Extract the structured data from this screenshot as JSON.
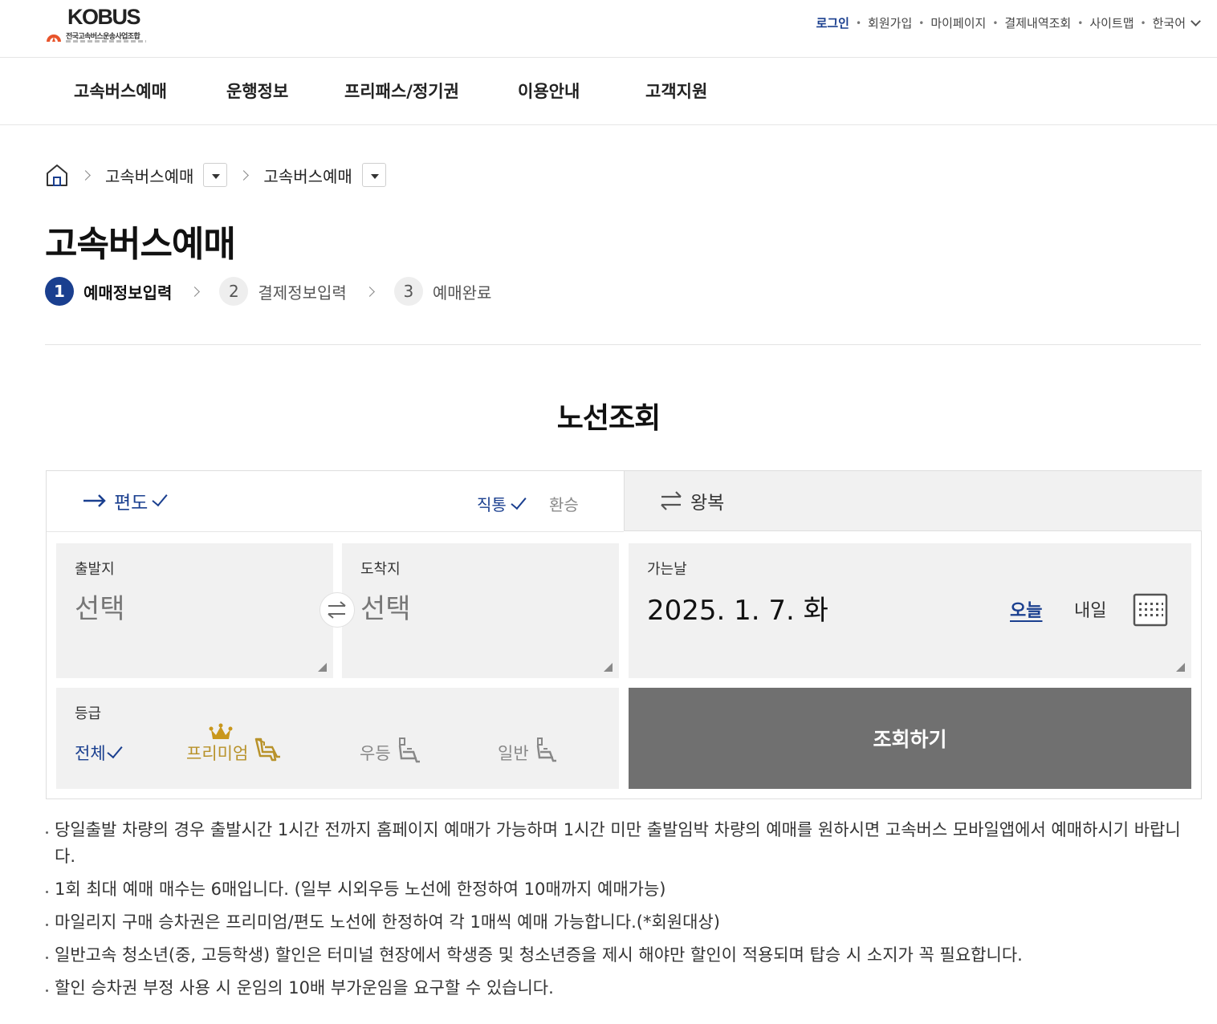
{
  "header": {
    "logo": {
      "wordmark": "KOBUS",
      "org_name": "전국고속버스운송사업조합"
    },
    "util_links": [
      "로그인",
      "회원가입",
      "마이페이지",
      "결제내역조회",
      "사이트맵",
      "한국어"
    ]
  },
  "gnb": [
    "고속버스예매",
    "운행정보",
    "프리패스/정기권",
    "이용안내",
    "고객지원"
  ],
  "breadcrumb": {
    "level1": "고속버스예매",
    "level2": "고속버스예매"
  },
  "page_title": "고속버스예매",
  "steps": [
    {
      "num": "1",
      "label": "예매정보입력",
      "active": true
    },
    {
      "num": "2",
      "label": "결제정보입력",
      "active": false
    },
    {
      "num": "3",
      "label": "예매완료",
      "active": false
    }
  ],
  "section_title": "노선조회",
  "trip_tabs": {
    "oneway": "편도",
    "roundtrip": "왕복",
    "direct": "직통",
    "transfer": "환승"
  },
  "departure": {
    "label": "출발지",
    "value": "선택"
  },
  "arrival": {
    "label": "도착지",
    "value": "선택"
  },
  "date": {
    "label": "가는날",
    "value": "2025. 1. 7. 화",
    "today": "오늘",
    "tomorrow": "내일"
  },
  "grade": {
    "label": "등급",
    "options": [
      "전체",
      "프리미엄",
      "우등",
      "일반"
    ],
    "selected": "전체"
  },
  "search_button": "조회하기",
  "notices": [
    "당일출발 차량의 경우 출발시간 1시간 전까지 홈페이지 예매가 가능하며 1시간 미만 출발임박 차량의 예매를 원하시면 고속버스 모바일앱에서 예매하시기 바랍니다.",
    "1회 최대 예매 매수는 6매입니다. (일부 시외우등 노선에 한정하여 10매까지 예매가능)",
    "마일리지 구매 승차권은 프리미엄/편도 노선에 한정하여 각 1매씩 예매 가능합니다.(*회원대상)",
    "일반고속 청소년(중, 고등학생) 할인은 터미널 현장에서 학생증 및 청소년증을 제시 해야만 할인이 적용되며 탑승 시 소지가 꼭 필요합니다.",
    "할인 승차권 부정 사용 시 운임의 10배 부가운임을 요구할 수 있습니다."
  ],
  "colors": {
    "primary": "#1a3f8f",
    "premium": "#b8922a",
    "button": "#707070",
    "field_bg": "#f1f1f1"
  }
}
